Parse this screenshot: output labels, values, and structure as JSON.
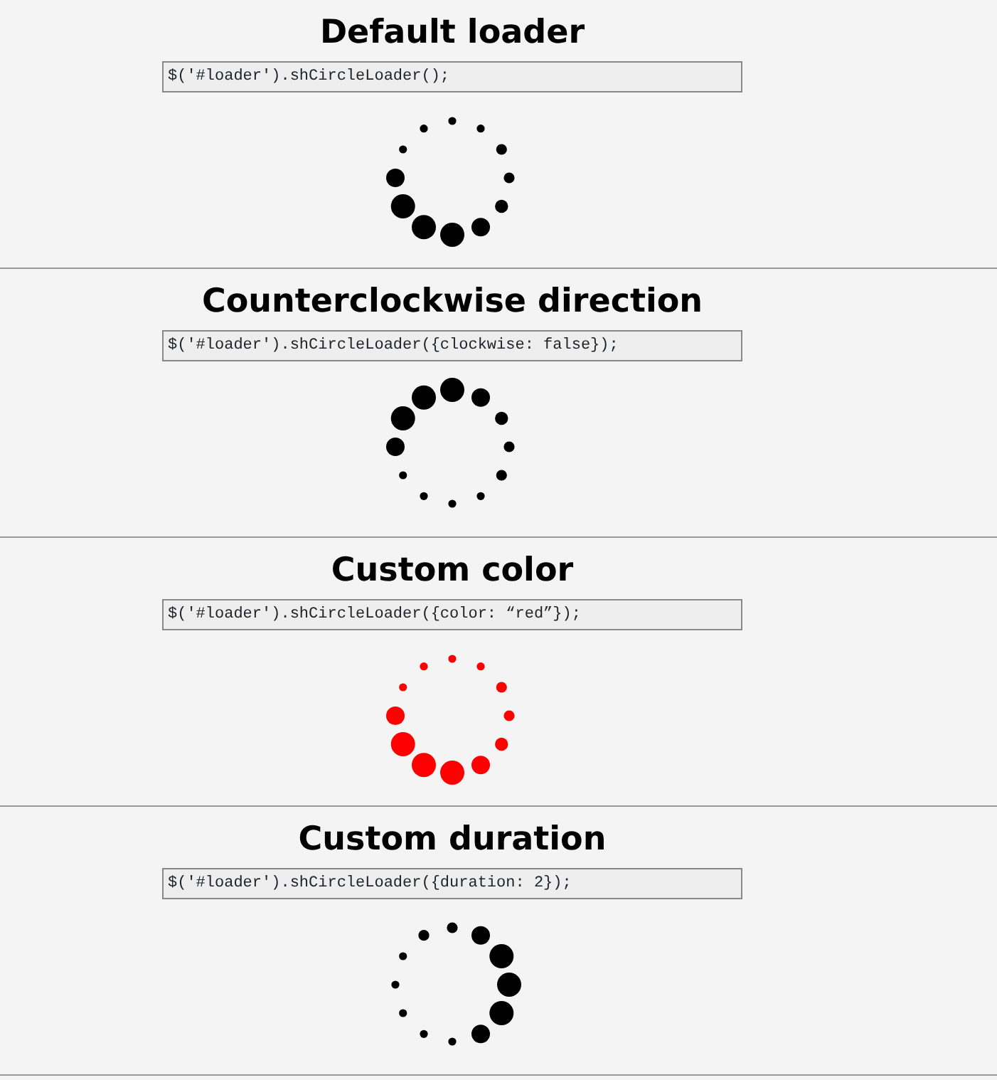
{
  "sections": [
    {
      "title": "Default loader",
      "code": "$('#loader').shCircleLoader();",
      "loader": {
        "color": "#000000",
        "dots": [
          {
            "kind": "xs"
          },
          {
            "kind": "xs"
          },
          {
            "kind": "s"
          },
          {
            "kind": "s"
          },
          {
            "kind": "m"
          },
          {
            "kind": "l"
          },
          {
            "kind": "xl"
          },
          {
            "kind": "xl"
          },
          {
            "kind": "xl"
          },
          {
            "kind": "l"
          },
          {
            "kind": "xs"
          },
          {
            "kind": "xs"
          }
        ]
      }
    },
    {
      "title": "Counterclockwise direction",
      "code": "$('#loader').shCircleLoader({clockwise: false});",
      "loader": {
        "color": "#000000",
        "dots": [
          {
            "kind": "xl"
          },
          {
            "kind": "l"
          },
          {
            "kind": "m"
          },
          {
            "kind": "s"
          },
          {
            "kind": "s"
          },
          {
            "kind": "xs"
          },
          {
            "kind": "xs"
          },
          {
            "kind": "xs"
          },
          {
            "kind": "xs"
          },
          {
            "kind": "l"
          },
          {
            "kind": "xl"
          },
          {
            "kind": "xl"
          }
        ]
      }
    },
    {
      "title": "Custom color",
      "code": "$('#loader').shCircleLoader({color: “red”});",
      "loader": {
        "color": "#ff0000",
        "dots": [
          {
            "kind": "xs"
          },
          {
            "kind": "xs"
          },
          {
            "kind": "s"
          },
          {
            "kind": "s"
          },
          {
            "kind": "m"
          },
          {
            "kind": "l"
          },
          {
            "kind": "xl"
          },
          {
            "kind": "xl"
          },
          {
            "kind": "xl"
          },
          {
            "kind": "l"
          },
          {
            "kind": "xs"
          },
          {
            "kind": "xs"
          }
        ]
      }
    },
    {
      "title": "Custom duration",
      "code": "$('#loader').shCircleLoader({duration: 2});",
      "loader": {
        "color": "#000000",
        "dots": [
          {
            "kind": "s"
          },
          {
            "kind": "l"
          },
          {
            "kind": "xl"
          },
          {
            "kind": "xl"
          },
          {
            "kind": "xl"
          },
          {
            "kind": "l"
          },
          {
            "kind": "xs"
          },
          {
            "kind": "xs"
          },
          {
            "kind": "xs"
          },
          {
            "kind": "xs"
          },
          {
            "kind": "xs"
          },
          {
            "kind": "s"
          }
        ]
      }
    }
  ]
}
